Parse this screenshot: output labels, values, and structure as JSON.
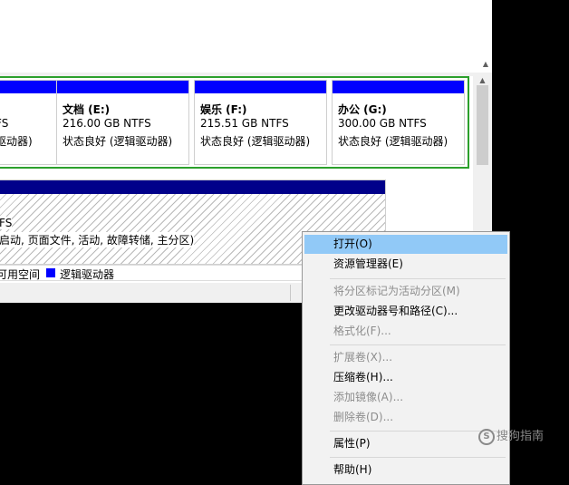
{
  "partitions": [
    {
      "name": "",
      "size": "FS",
      "status": "驱动器)"
    },
    {
      "name": "文档 (E:)",
      "size": "216.00 GB NTFS",
      "status": "状态良好 (逻辑驱动器)"
    },
    {
      "name": "娱乐 (F:)",
      "size": "215.51 GB NTFS",
      "status": "状态良好 (逻辑驱动器)"
    },
    {
      "name": "办公 (G:)",
      "size": "300.00 GB NTFS",
      "status": "状态良好 (逻辑驱动器)"
    }
  ],
  "disk2": {
    "fs": "FS",
    "status": "启动, 页面文件, 活动, 故障转储, 主分区)"
  },
  "legend": {
    "unallocated": "可用空间",
    "logical": "逻辑驱动器"
  },
  "context_menu": {
    "items": [
      {
        "label": "打开(O)",
        "enabled": true
      },
      {
        "label": "资源管理器(E)",
        "enabled": true
      },
      {
        "label": "将分区标记为活动分区(M)",
        "enabled": false
      },
      {
        "label": "更改驱动器号和路径(C)...",
        "enabled": true
      },
      {
        "label": "格式化(F)...",
        "enabled": false
      },
      {
        "label": "扩展卷(X)...",
        "enabled": false
      },
      {
        "label": "压缩卷(H)...",
        "enabled": true
      },
      {
        "label": "添加镜像(A)...",
        "enabled": false
      },
      {
        "label": "删除卷(D)...",
        "enabled": false
      },
      {
        "label": "属性(P)",
        "enabled": true
      },
      {
        "label": "帮助(H)",
        "enabled": true
      }
    ]
  },
  "watermark": {
    "icon_text": "S",
    "text": "搜狗指南"
  },
  "colors": {
    "partition_bar": "#0000ff",
    "primary_bar": "#00008a",
    "selection_border": "#2ca02c",
    "menu_highlight": "#91c9f7"
  }
}
